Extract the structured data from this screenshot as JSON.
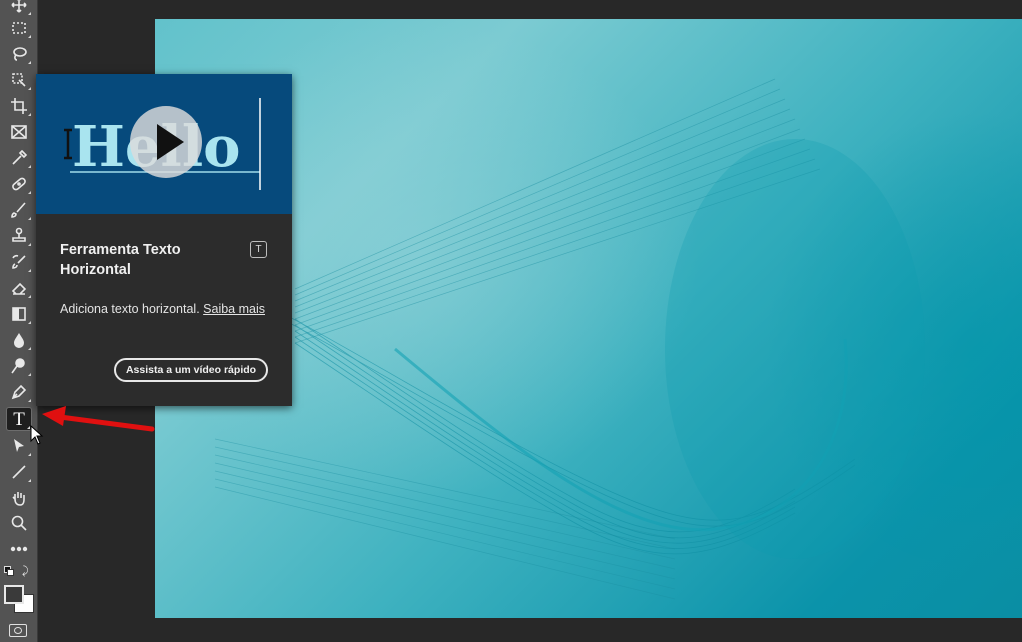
{
  "toolbar": {
    "tools": [
      {
        "name": "move-tool",
        "icon": "move-icon"
      },
      {
        "name": "marquee-tool",
        "icon": "rect-marquee-icon"
      },
      {
        "name": "lasso-tool",
        "icon": "lasso-icon"
      },
      {
        "name": "object-selection-tool",
        "icon": "object-select-icon"
      },
      {
        "name": "crop-tool",
        "icon": "crop-icon"
      },
      {
        "name": "frame-tool",
        "icon": "frame-icon"
      },
      {
        "name": "eyedropper-tool",
        "icon": "eyedropper-icon"
      },
      {
        "name": "healing-brush-tool",
        "icon": "bandage-icon"
      },
      {
        "name": "brush-tool",
        "icon": "brush-icon"
      },
      {
        "name": "clone-stamp-tool",
        "icon": "stamp-icon"
      },
      {
        "name": "history-brush-tool",
        "icon": "history-brush-icon"
      },
      {
        "name": "eraser-tool",
        "icon": "eraser-icon"
      },
      {
        "name": "gradient-tool",
        "icon": "gradient-icon"
      },
      {
        "name": "blur-tool",
        "icon": "drop-icon"
      },
      {
        "name": "dodge-tool",
        "icon": "dodge-icon"
      },
      {
        "name": "pen-tool",
        "icon": "pen-icon"
      },
      {
        "name": "type-tool",
        "icon": "type-icon",
        "glyph": "T"
      },
      {
        "name": "path-selection-tool",
        "icon": "arrow-select-icon"
      },
      {
        "name": "line-tool",
        "icon": "line-icon"
      },
      {
        "name": "hand-tool",
        "icon": "hand-icon"
      },
      {
        "name": "zoom-tool",
        "icon": "zoom-icon"
      },
      {
        "name": "more-tools",
        "icon": "ellipsis-icon"
      }
    ]
  },
  "tooltip": {
    "video_text": "Hello",
    "title": "Ferramenta Texto Horizontal",
    "shortcut": "T",
    "description": "Adiciona texto horizontal.",
    "learn_more": "Saiba mais",
    "watch_button": "Assista a um vídeo rápido"
  },
  "colors": {
    "toolbar_bg": "#535353",
    "workspace_bg": "#282828",
    "tooltip_bg": "#2c2c2c",
    "video_bg": "#064a7c",
    "arrow": "#e01010"
  }
}
